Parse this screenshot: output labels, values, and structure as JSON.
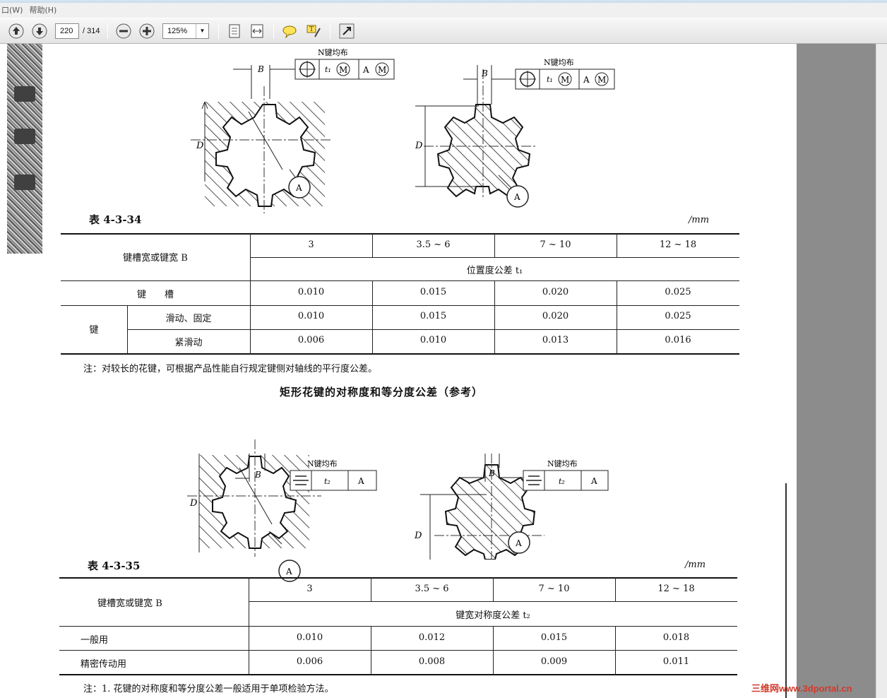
{
  "menu": [
    "口(W)",
    "帮助(H)"
  ],
  "toolbar": {
    "page_current": "220",
    "page_total": "/ 314",
    "zoom": "125%"
  },
  "figure1": {
    "left_frame": {
      "b": "B",
      "n_label": "N键均布",
      "t": "t₁",
      "m": "M",
      "a": "A"
    },
    "right_frame": {
      "b": "B",
      "n_label": "N键均布",
      "t": "t₁",
      "m": "M",
      "a": "A"
    },
    "d_label": "D",
    "datum": "A"
  },
  "table1": {
    "title": "表 4-3-34",
    "unit": "/mm",
    "row_header": "键槽宽或键宽 B",
    "cols": [
      "3",
      "3.5 ~ 6",
      "7 ~ 10",
      "12 ~ 18"
    ],
    "subheader": "位置度公差 t₁",
    "rows": [
      {
        "group": "",
        "label": "键　　槽",
        "values": [
          "0.010",
          "0.015",
          "0.020",
          "0.025"
        ]
      },
      {
        "group": "键",
        "label": "滑动、固定",
        "values": [
          "0.010",
          "0.015",
          "0.020",
          "0.025"
        ]
      },
      {
        "group": "",
        "label": "紧滑动",
        "values": [
          "0.006",
          "0.010",
          "0.013",
          "0.016"
        ]
      }
    ],
    "note": "注：对较长的花键，可根据产品性能自行规定键侧对轴线的平行度公差。"
  },
  "section_heading": "矩形花键的对称度和等分度公差（参考）",
  "figure2": {
    "left_frame": {
      "b": "B",
      "n_label": "N键均布",
      "t": "t₂",
      "a": "A"
    },
    "right_frame": {
      "b": "B",
      "n_label": "N键均布",
      "t": "t₂",
      "a": "A"
    },
    "d_label": "D",
    "datum": "A"
  },
  "table2": {
    "title": "表 4-3-35",
    "unit": "/mm",
    "row_header": "键槽宽或键宽 B",
    "cols": [
      "3",
      "3.5 ~ 6",
      "7 ~ 10",
      "12 ~ 18"
    ],
    "subheader": "键宽对称度公差 t₂",
    "rows": [
      {
        "label": "一般用",
        "values": [
          "0.010",
          "0.012",
          "0.015",
          "0.018"
        ]
      },
      {
        "label": "精密传动用",
        "values": [
          "0.006",
          "0.008",
          "0.009",
          "0.011"
        ]
      }
    ],
    "note": "注：1. 花键的对称度和等分度公差一般适用于单项检验方法。"
  },
  "watermark": "三维网www.3dportal.cn"
}
